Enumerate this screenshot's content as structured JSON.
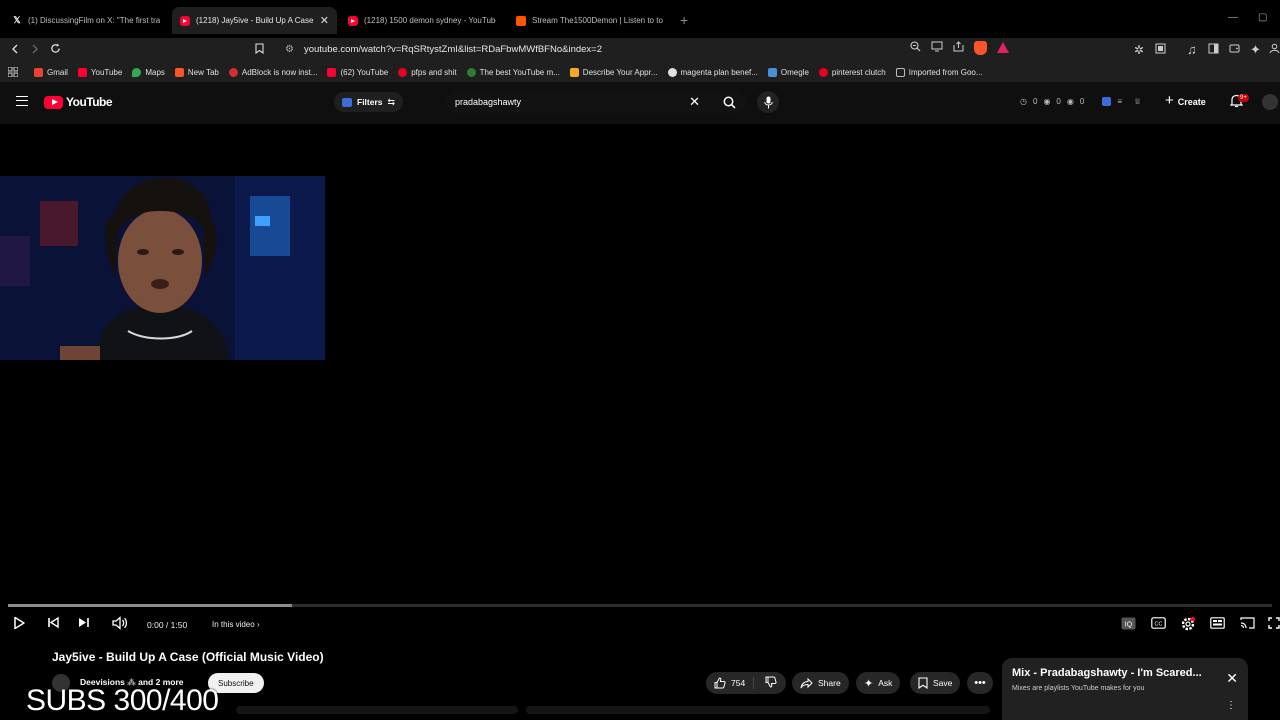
{
  "browser": {
    "tabs": [
      {
        "icon": "x-icon",
        "label": "(1) DiscussingFilm on X: \"The first tra"
      },
      {
        "icon": "youtube-icon",
        "label": "(1218) Jay5ive - Build Up A Case",
        "active": true
      },
      {
        "icon": "youtube-icon",
        "label": "(1218) 1500 demon sydney - YouTube"
      },
      {
        "icon": "soundcloud-icon",
        "label": "Stream The1500Demon | Listen to to"
      }
    ],
    "new_tab": "+",
    "url": "youtube.com/watch?v=RqSRtystZmI&list=RDaFbwMWfBFNo&index=2"
  },
  "bookmarks": [
    {
      "label": "Gmail",
      "color": "#ea4335"
    },
    {
      "label": "YouTube",
      "color": "#ff0033"
    },
    {
      "label": "Maps",
      "color": "#34a853"
    },
    {
      "label": "New Tab",
      "color": "#fb542b"
    },
    {
      "label": "AdBlock is now inst...",
      "color": "#d32f2f"
    },
    {
      "label": "(62) YouTube",
      "color": "#ff0033"
    },
    {
      "label": "pfps and shit",
      "color": "#e60023"
    },
    {
      "label": "The best YouTube m...",
      "color": "#2e7d32"
    },
    {
      "label": "Describe Your Appr...",
      "color": "#f9a825"
    },
    {
      "label": "magenta plan benef...",
      "color": "#e0e0e0"
    },
    {
      "label": "Omegle",
      "color": "#4a90d9"
    },
    {
      "label": "pinterest clutch",
      "color": "#e60023"
    },
    {
      "label": "Imported from Goo...",
      "color": "#9e9e9e"
    }
  ],
  "youtube": {
    "logo": "YouTube",
    "filters": "Filters",
    "search_query": "pradabagshawty",
    "stats": [
      "0",
      "0",
      "0"
    ],
    "create": "Create",
    "notif_badge": "9+"
  },
  "player": {
    "time": "0:00 / 1:50",
    "chapters": "In this video",
    "progress": 0.0,
    "buffered": 0.225
  },
  "video": {
    "title": "Jay5ive - Build Up A Case (Official Music Video)",
    "channel": "Deevisions",
    "collab": "and 2 more",
    "subscribe": "Subscribe",
    "likes": "754",
    "share": "Share",
    "ask": "Ask",
    "save": "Save"
  },
  "overlay": {
    "subs": "SUBS 300/400"
  },
  "mix": {
    "title": "Mix - Pradabagshawty - I'm Scared...",
    "subtitle": "Mixes are playlists YouTube makes for you"
  },
  "colors": {
    "youtube_red": "#ff0033",
    "background": "#0f0f0f"
  }
}
